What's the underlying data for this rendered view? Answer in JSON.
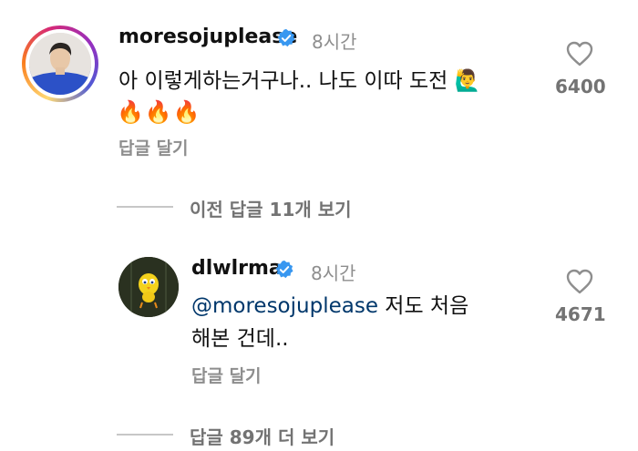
{
  "comment1": {
    "username": "moresojuplease",
    "time": "8시간",
    "text": "아 이렇게하는거구나.. 나도 이따 도전 🙋‍♂️",
    "emoji_line": "🔥🔥🔥",
    "reply_label": "답글 달기",
    "likes": "6400",
    "verified": true
  },
  "view_previous": "이전 답글 11개 보기",
  "comment2": {
    "username": "dlwlrma",
    "time": "8시간",
    "mention": "@moresojuplease",
    "text_line1": "저도 처음",
    "text_line2": "해본 건데..",
    "reply_label": "답글 달기",
    "likes": "4671",
    "verified": true
  },
  "view_more": "답글 89개 더 보기",
  "colors": {
    "verified": "#3897f0",
    "mention": "#00376b",
    "muted": "#737373"
  }
}
